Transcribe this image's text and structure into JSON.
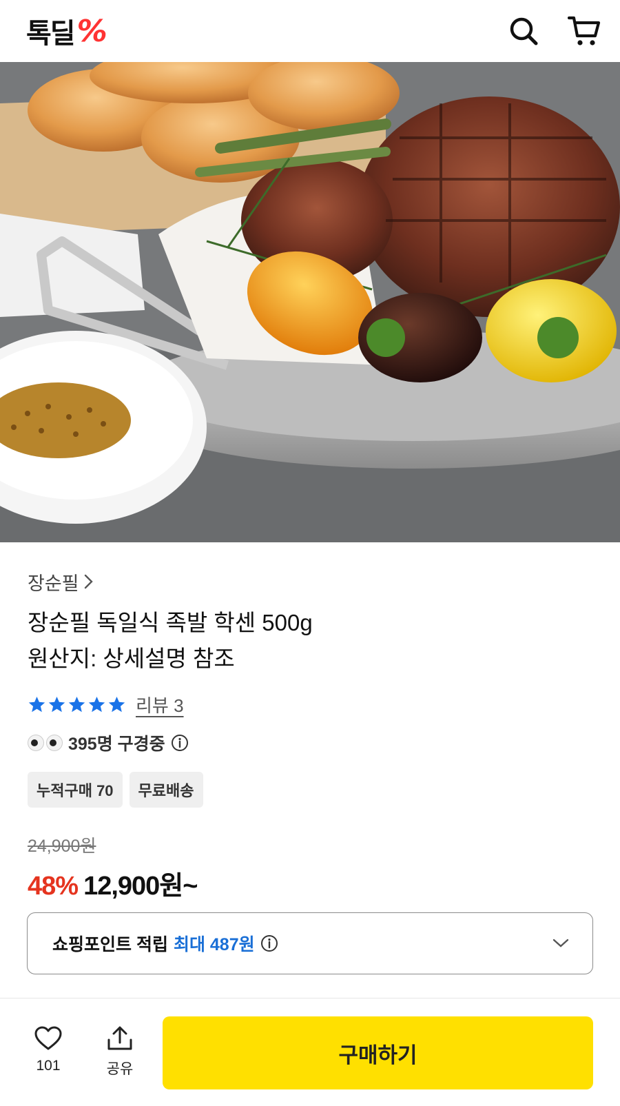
{
  "header": {
    "logo_text": "톡딜",
    "logo_mark": "%",
    "search_icon": "search-icon",
    "cart_icon": "cart-icon"
  },
  "product": {
    "brand": "장순필",
    "title_line1": "장순필 독일식 족발 학센 500g",
    "title_line2": "원산지: 상세설명 참조",
    "rating_stars": 5,
    "review_label": "리뷰 3",
    "watching_text": "395명 구경중",
    "badges": [
      "누적구매 70",
      "무료배송"
    ],
    "original_price": "24,900원",
    "discount": "48%",
    "price": "12,900원~"
  },
  "points": {
    "label": "쇼핑포인트 적립",
    "accent": "최대 487원"
  },
  "bottom": {
    "like_count": "101",
    "share_label": "공유",
    "buy_label": "구매하기"
  },
  "colors": {
    "accent_red": "#e5341f",
    "accent_blue": "#1a6fd6",
    "buy_yellow": "#ffe000",
    "star_blue": "#1a73e8"
  }
}
